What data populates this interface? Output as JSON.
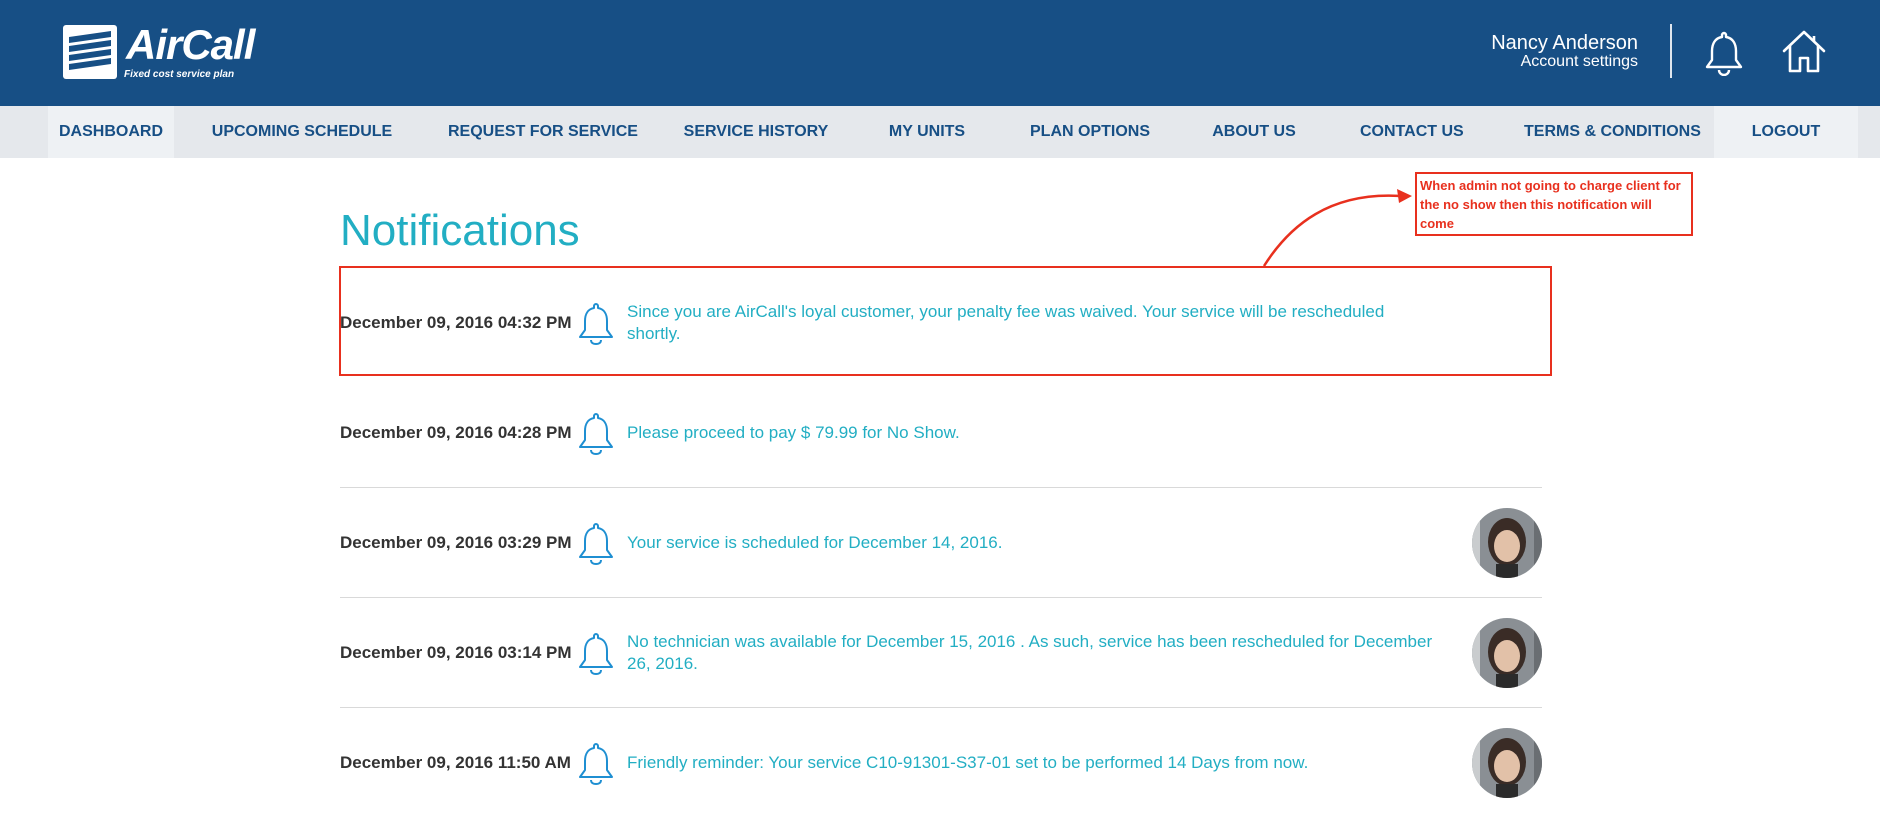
{
  "header": {
    "logo_text": "AirCall",
    "logo_tagline": "Fixed cost service plan",
    "user_name": "Nancy Anderson",
    "account_link": "Account settings"
  },
  "nav": {
    "items": [
      {
        "label": "DASHBOARD"
      },
      {
        "label": "UPCOMING SCHEDULE"
      },
      {
        "label": "REQUEST FOR SERVICE"
      },
      {
        "label": "SERVICE HISTORY"
      },
      {
        "label": "MY UNITS"
      },
      {
        "label": "PLAN OPTIONS"
      },
      {
        "label": "ABOUT US"
      },
      {
        "label": "CONTACT US"
      },
      {
        "label": "TERMS & CONDITIONS"
      },
      {
        "label": "LOGOUT"
      }
    ]
  },
  "page": {
    "title": "Notifications"
  },
  "notifications": [
    {
      "timestamp": "December 09, 2016 04:32 PM",
      "message": "Since you are AirCall's loyal customer, your penalty fee was waived. Your service will be rescheduled shortly."
    },
    {
      "timestamp": "December 09, 2016 04:28 PM",
      "message": "Please proceed to pay $ 79.99 for No Show."
    },
    {
      "timestamp": "December 09, 2016 03:29 PM",
      "message": "Your service is scheduled for December 14, 2016."
    },
    {
      "timestamp": "December 09, 2016 03:14 PM",
      "message": "No technician was available for December 15, 2016 . As such, service has been rescheduled for December 26, 2016."
    },
    {
      "timestamp": "December 09, 2016 11:50 AM",
      "message": "Friendly reminder: Your service C10-91301-S37-01 set to be performed 14 Days from now."
    }
  ],
  "annotation": {
    "note": "When admin not going to charge client for the no show then this notification will come"
  },
  "colors": {
    "header_bg": "#174f85",
    "nav_bg": "#e5e8ec",
    "accent_teal": "#22aec3",
    "annotation_red": "#e8301e"
  },
  "icons": {
    "header_bell": "bell-icon",
    "header_home": "home-icon",
    "row_bell": "bell-icon"
  }
}
